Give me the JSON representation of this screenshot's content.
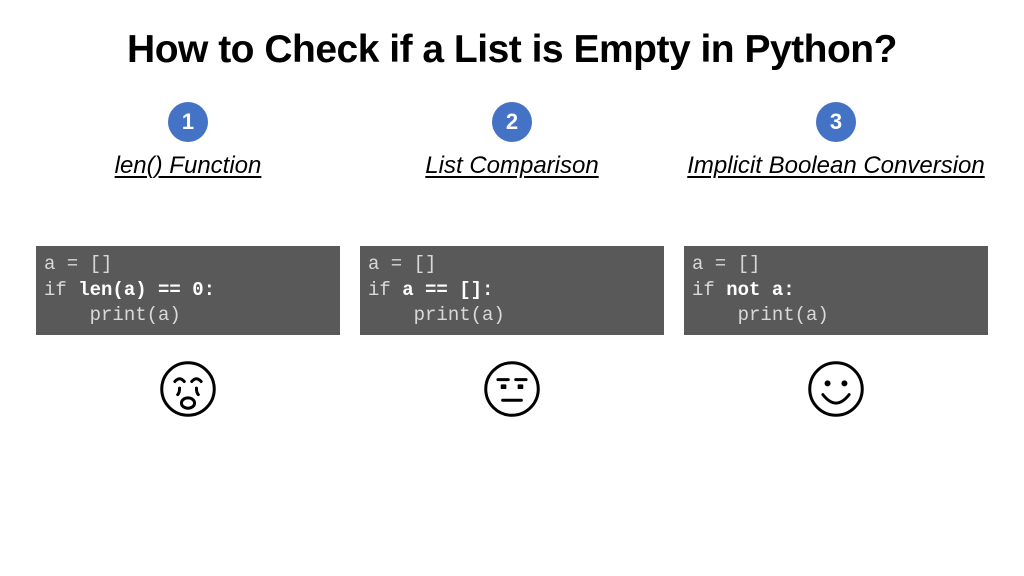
{
  "title": "How to Check if a List is Empty in Python?",
  "columns": [
    {
      "badge": "1",
      "heading": "len() Function",
      "code_html": "a = []\nif <span class=\"b\">len(a) == 0:</span>\n    print(a)",
      "face": "sad"
    },
    {
      "badge": "2",
      "heading": "List Comparison",
      "code_html": "a = []\nif <span class=\"b\">a == []:</span>\n    print(a)",
      "face": "neutral"
    },
    {
      "badge": "3",
      "heading": "Implicit Boolean Conversion",
      "code_html": "a = []\nif <span class=\"b\">not a:</span>\n    print(a)",
      "face": "happy"
    }
  ],
  "colors": {
    "accent_blue": "#4472c4",
    "code_bg": "#595959"
  }
}
